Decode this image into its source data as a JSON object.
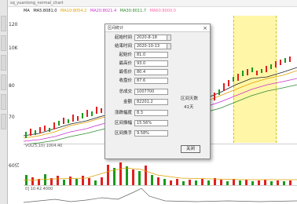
{
  "window": {
    "title": "sq_yuantong_normal_chart"
  },
  "ma_legend": {
    "label": "MA",
    "items": [
      {
        "text": "MA5:8081.0",
        "color": "#222222"
      },
      {
        "text": "MA10:8054.2",
        "color": "#e0a000"
      },
      {
        "text": "MA20:8021.4",
        "color": "#cc33cc"
      },
      {
        "text": "MA30:8011.7",
        "color": "#2e8b2e"
      },
      {
        "text": "MA60:8000.0",
        "color": "#ff66aa"
      }
    ]
  },
  "price_axis": [
    "120",
    "10K",
    "80",
    "70"
  ],
  "volume_label": "VOL(5,10) 1004.40",
  "volume_unit": "60亿",
  "osc_label": "0] 10.42.4000",
  "dialog": {
    "title": "区间统计",
    "close": "×",
    "fields": [
      {
        "label": "起始时间",
        "value": "2020-8-18"
      },
      {
        "label": "结束时间",
        "value": "2020-10-13"
      },
      {
        "label": "起始价",
        "value": "81.0"
      },
      {
        "label": "最高价",
        "value": "93.0"
      },
      {
        "label": "最低价",
        "value": "80.4"
      },
      {
        "label": "收盘价",
        "value": "87.6"
      },
      {
        "label": "总成交",
        "value": "1007700"
      },
      {
        "label": "金额",
        "value": "82201.2"
      },
      {
        "label": "涨跌幅度",
        "value": "8.3"
      },
      {
        "label": "区间振幅",
        "value": "15.56%"
      },
      {
        "label": "区间换手",
        "value": "9.58%"
      }
    ],
    "side_label_1": "区间天数",
    "side_value_1": "41天",
    "ok": "关闭"
  },
  "colors": {
    "up": "#e02020",
    "down": "#1a9a1a",
    "highlight": "#fff6a8"
  }
}
